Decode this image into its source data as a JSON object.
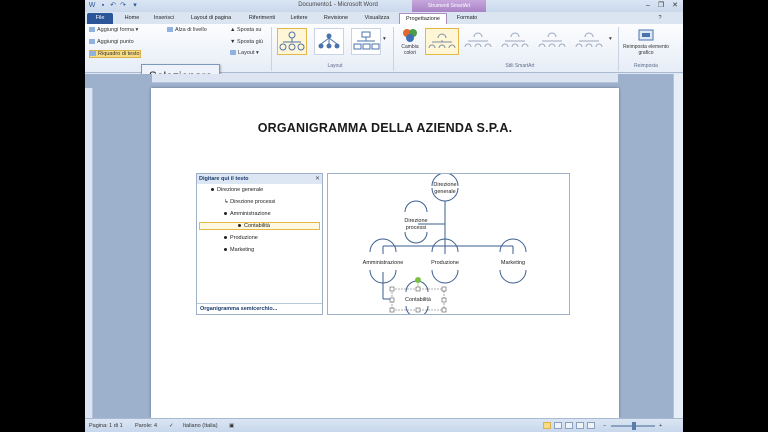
{
  "window": {
    "title": "Documento1 - Microsoft Word",
    "contextual_group": "Strumenti SmartArt"
  },
  "tabs": [
    "File",
    "Home",
    "Inserisci",
    "Layout di pagina",
    "Riferimenti",
    "Lettere",
    "Revisione",
    "Visualizza",
    "Progettazione",
    "Formato"
  ],
  "ribbon": {
    "create_graphic": {
      "add_shape": "Aggiungi forma",
      "add_bullet": "Aggiungi punto",
      "text_pane": "Riquadro di testo",
      "promote": "Alza di livello",
      "move_up": "Sposta su",
      "move_down": "Sposta giù",
      "layout": "Layout"
    },
    "tooltip": "Selezionare",
    "layouts_label": "Layout",
    "change_colors": "Cambia colori",
    "styles_label": "Stili SmartArt",
    "reset_graphic": "Reimposta elemento grafico",
    "reset_label": "Reimposta"
  },
  "document": {
    "heading": "ORGANIGRAMMA DELLA AZIENDA S.P.A."
  },
  "text_pane": {
    "title": "Digitare qui il testo",
    "items": [
      "Direzione generale",
      "Direzione processi",
      "Amministrazione",
      "Contabilità",
      "Produzione",
      "Marketing"
    ],
    "footer": "Organigramma semicerchio..."
  },
  "smartart": {
    "nodes": {
      "top": "Direzione generale",
      "assistant": "Direzione processi",
      "left": "Amministrazione",
      "middle": "Produzione",
      "right": "Marketing",
      "child": "Contabilità"
    }
  },
  "status": {
    "page": "Pagina: 1 di 1",
    "words": "Parole: 4",
    "language": "Italiano (Italia)"
  },
  "colors": {
    "file_tab": "#2a5599",
    "contextual": "#a984c6",
    "selection": "#e3b74a",
    "node_line": "#3b5f8f"
  }
}
